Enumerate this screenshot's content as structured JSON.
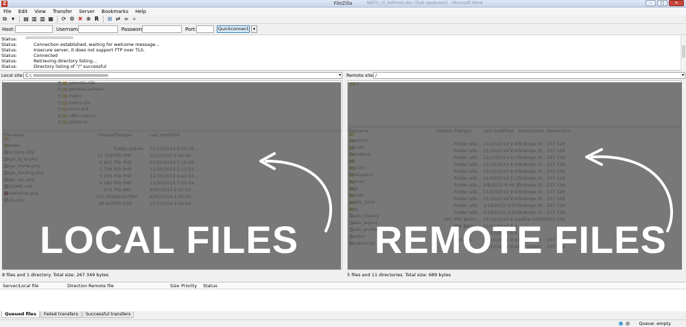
{
  "window": {
    "title": "FileZilla",
    "title_hint": "NBTO_Ul_listfinish.doc (Tryb zgodności) - Microsoft Word",
    "controls": [
      "–",
      "□",
      "✕"
    ]
  },
  "menu": [
    "File",
    "Edit",
    "View",
    "Transfer",
    "Server",
    "Bookmarks",
    "Help"
  ],
  "toolbar": {
    "icons": [
      "site-manager-icon",
      "dropdown-icon",
      "toggle-log-icon",
      "toggle-tree-local-icon",
      "toggle-tree-remote-icon",
      "toggle-queue-icon",
      "refresh-icon",
      "process-queue-icon",
      "cancel-icon",
      "disconnect-icon",
      "reconnect-icon",
      "filter-icon",
      "compare-icon",
      "sync-browse-icon",
      "search-icon"
    ],
    "glyphs": [
      "⧉",
      "▾",
      "▤",
      "▥",
      "▥",
      "▦",
      "⟳",
      "⚙",
      "✖",
      "⊗",
      "R",
      "⊞",
      "⇄",
      "∞",
      "⌕"
    ]
  },
  "quickconnect": {
    "host_label": "Host:",
    "username_label": "Username:",
    "password_label": "Password:",
    "port_label": "Port:",
    "button_label": "Quickconnect",
    "dropdown_glyph": "▾",
    "host_value": "",
    "username_value": "",
    "password_value": "",
    "port_value": ""
  },
  "log": [
    {
      "key": "Status:",
      "msg": ""
    },
    {
      "key": "Status:",
      "msg": "Connection established, waiting for welcome message..."
    },
    {
      "key": "Status:",
      "msg": "Insecure server, it does not support FTP over TLS."
    },
    {
      "key": "Status:",
      "msg": "Connected"
    },
    {
      "key": "Status:",
      "msg": "Retrieving directory listing..."
    },
    {
      "key": "Status:",
      "msg": "Directory listing of \"/\" successful"
    }
  ],
  "local": {
    "site_label": "Local site:",
    "path": "C:\\",
    "tree": [
      "genesis-nile",
      "genesis-sample",
      "metro",
      "metro-pro",
      "minicard",
      "n8D-custom",
      "photoria"
    ],
    "headers": [
      "Filename",
      "Filesize",
      "Filetype",
      "Last modified"
    ],
    "files": [
      {
        "name": "..",
        "size": "",
        "type": "",
        "modified": "",
        "kind": "folder"
      },
      {
        "name": "images",
        "size": "",
        "type": "Folder plików",
        "modified": "11/23/2014 6:25:16...",
        "kind": "folder"
      },
      {
        "name": "functions.php",
        "size": "11 358",
        "type": "Plik PHP",
        "modified": "3/12/2015 2:48:40 ...",
        "kind": "file"
      },
      {
        "name": "page_lg_lp.php",
        "size": "2 851",
        "type": "Plik PHP",
        "modified": "11/30/2014 7:19:09...",
        "kind": "file"
      },
      {
        "name": "page_home.php",
        "size": "1 708",
        "type": "Plik PHP",
        "modified": "11/30/2014 5:11:53...",
        "kind": "file"
      },
      {
        "name": "page_landing.php",
        "size": "1 033",
        "type": "Plik PHP",
        "modified": "11/30/2014 6:42:03...",
        "kind": "file"
      },
      {
        "name": "page_ssc.php",
        "size": "6 582",
        "type": "Plik PHP",
        "modified": "11/30/2014 7:23:54...",
        "kind": "file"
      },
      {
        "name": "README.md",
        "size": "576",
        "type": "Plik MD",
        "modified": "6/30/2014 2:47:00 ...",
        "kind": "file"
      },
      {
        "name": "screenshot.png",
        "size": "213 629",
        "type": "Obraz PNG",
        "modified": "6/30/2014 2:47:00 ...",
        "kind": "image"
      },
      {
        "name": "style.css",
        "size": "29 602",
        "type": "Plik CSS",
        "modified": "12/7/2014 3:49:29 ...",
        "kind": "file"
      }
    ],
    "summary": "8 files and 1 directory. Total size: 267 349 bytes",
    "overlay_label": "LOCAL FILES"
  },
  "remote": {
    "site_label": "Remote site:",
    "path": "/",
    "tree": [
      "/"
    ],
    "headers": [
      "Filename",
      "Filesize",
      "Filetype",
      "Last modified",
      "Permissions",
      "Owner/Gro..."
    ],
    "files": [
      {
        "name": "..",
        "size": "",
        "type": "",
        "modified": "",
        "perms": "",
        "owner": "",
        "kind": "folder"
      },
      {
        "name": ".usermin",
        "size": "",
        "type": "Folder plik...",
        "modified": "11/10/2014 9:4...",
        "perms": "flcdmpe (0...",
        "owner": "537 526",
        "kind": "folder"
      },
      {
        "name": "cgi-bin",
        "size": "",
        "type": "Folder plik...",
        "modified": "11/10/2014 9:4...",
        "perms": "flcdmpe (0...",
        "owner": "537 526",
        "kind": "folder"
      },
      {
        "name": "Database",
        "size": "",
        "type": "Folder plik...",
        "modified": "11/10/2014 5:1...",
        "perms": "flcdmpe (0...",
        "owner": "537 526",
        "kind": "folder"
      },
      {
        "name": "etc",
        "size": "",
        "type": "Folder plik...",
        "modified": "11/10/2014 9:4...",
        "perms": "flcdmpe (0...",
        "owner": "537 526",
        "kind": "folder"
      },
      {
        "name": "fcgi-bin",
        "size": "",
        "type": "Folder plik...",
        "modified": "11/10/2014 9:4...",
        "perms": "flcdmpe (0...",
        "owner": "537 526",
        "kind": "folder"
      },
      {
        "name": "FileSystem",
        "size": "",
        "type": "Folder plik...",
        "modified": "11/10/2014 5:1...",
        "perms": "flcdmpe (0...",
        "owner": "537 526",
        "kind": "folder"
      },
      {
        "name": "homes",
        "size": "",
        "type": "Folder plik...",
        "modified": "3/9/2015 6:46:3...",
        "perms": "flcdmpe (0...",
        "owner": "537 526",
        "kind": "folder"
      },
      {
        "name": "logs",
        "size": "",
        "type": "Folder plik...",
        "modified": "11/10/2014 9:4...",
        "perms": "flcdmpe (0...",
        "owner": "537 526",
        "kind": "folder"
      },
      {
        "name": "Maildir",
        "size": "",
        "type": "Folder plik...",
        "modified": "11/10/2014 9:4...",
        "perms": "flcdmpe (0...",
        "owner": "537 526",
        "kind": "folder"
      },
      {
        "name": "public_html",
        "size": "",
        "type": "Folder plik...",
        "modified": "3/16/2015 3:07:...",
        "perms": "flcdmpe (0...",
        "owner": "537 526",
        "kind": "folder"
      },
      {
        "name": "tmp",
        "size": "",
        "type": "Folder plik...",
        "modified": "3/16/2015 2:23:...",
        "perms": "flcdmpe (0...",
        "owner": "537 526",
        "kind": "folder"
      },
      {
        "name": ".bash_history",
        "size": "193",
        "type": "Plik BASH_...",
        "modified": "11/16/2014 8:3...",
        "perms": "adfrw (0600)",
        "owner": "537 526",
        "kind": "file"
      },
      {
        "name": ".bash_logout",
        "size": "",
        "type": "Plik BASH_...",
        "modified": "11/10/2014 9:4...",
        "perms": "",
        "owner": "",
        "kind": "file"
      },
      {
        "name": ".bash_profile",
        "size": "",
        "type": "",
        "modified": "11/10/2014 9:4...",
        "perms": "",
        "owner": "",
        "kind": "file"
      },
      {
        "name": ".bashrc",
        "size": "",
        "type": "BASHRC",
        "modified": "11/10/2014 9:4...",
        "perms": "frw (0644)",
        "owner": "537 526",
        "kind": "file"
      },
      {
        "name": "Readme.txt",
        "size": "",
        "type": "",
        "modified": "11/10/2014 9:4...",
        "perms": "frw (0644)",
        "owner": "537 526",
        "kind": "file"
      }
    ],
    "summary": "5 files and 11 directories. Total size: 689 bytes",
    "overlay_label": "REMOTE FILES"
  },
  "queue": {
    "headers": [
      "Server/Local file",
      "Direction",
      "Remote file",
      "Size",
      "Priority",
      "Status"
    ],
    "tabs": [
      "Queued files",
      "Failed transfers",
      "Successful transfers"
    ],
    "status": "Queue: empty"
  }
}
